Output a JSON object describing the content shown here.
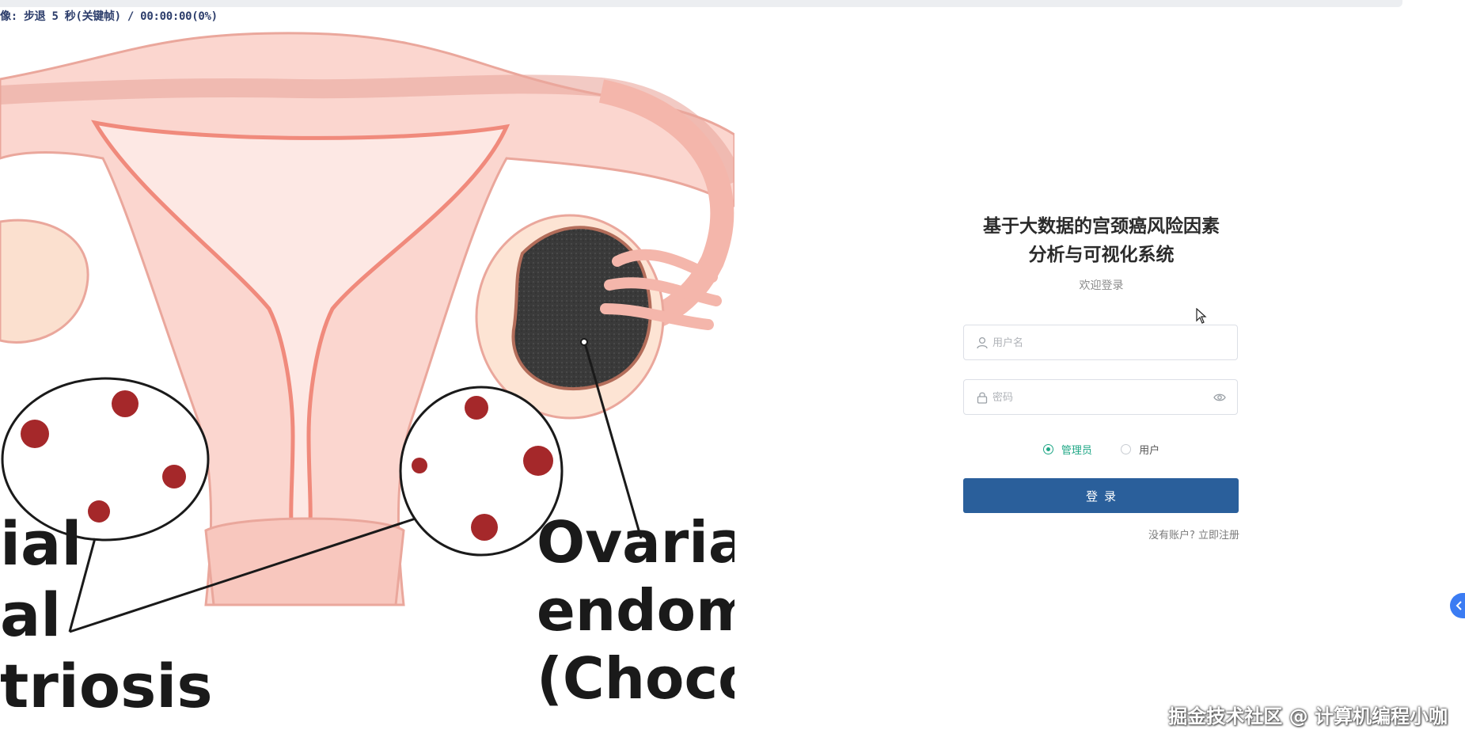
{
  "overlay": {
    "text": "像: 步退 5 秒(关键帧) / 00:00:00(0%)"
  },
  "illustration": {
    "labels": {
      "left_line1": "ial",
      "left_line2": "al",
      "left_line3": "triosis",
      "right_line1": "Ovaria",
      "right_line2": "endom",
      "right_line3": "(Chocol"
    }
  },
  "login": {
    "title_line1": "基于大数据的宫颈癌风险因素",
    "title_line2": "分析与可视化系统",
    "subtitle": "欢迎登录",
    "username_placeholder": "用户名",
    "password_placeholder": "密码",
    "roles": [
      {
        "label": "管理员",
        "selected": true
      },
      {
        "label": "用户",
        "selected": false
      }
    ],
    "login_button": "登录",
    "register_link": "没有账户? 立即注册"
  },
  "watermark": "掘金技术社区 @ 计算机编程小咖",
  "colors": {
    "primary_button": "#2a5f9b",
    "radio_selected": "#1fa786",
    "side_handle": "#3b7cf3"
  },
  "icons": [
    "user-icon",
    "lock-icon",
    "eye-icon",
    "chevron-left-icon",
    "mouse-cursor-icon"
  ]
}
